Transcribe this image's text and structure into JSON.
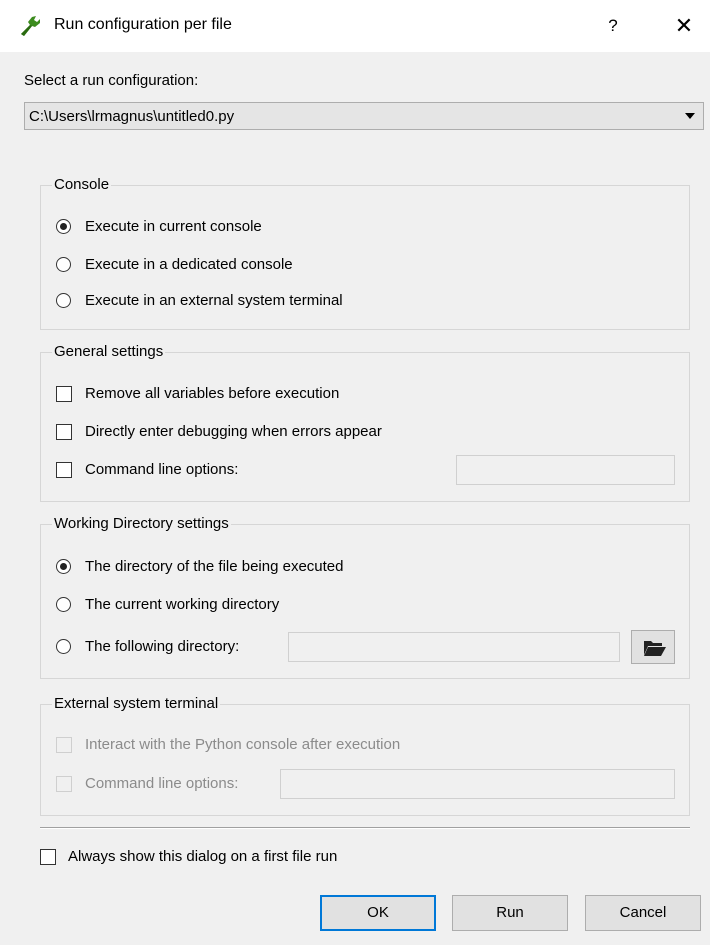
{
  "window": {
    "title": "Run configuration per file",
    "help": "?",
    "close": "✕"
  },
  "selector": {
    "label": "Select a run configuration:",
    "value": "C:\\Users\\lrmagnus\\untitled0.py"
  },
  "console": {
    "title": "Console",
    "options": [
      {
        "label": "Execute in current console",
        "checked": true
      },
      {
        "label": "Execute in a dedicated console",
        "checked": false
      },
      {
        "label": "Execute in an external system terminal",
        "checked": false
      }
    ]
  },
  "general": {
    "title": "General settings",
    "remove_vars": "Remove all variables before execution",
    "debug": "Directly enter debugging when errors appear",
    "cmd_options": "Command line options:",
    "cmd_value": ""
  },
  "workdir": {
    "title": "Working Directory settings",
    "options": [
      {
        "label": "The directory of the file being executed",
        "checked": true
      },
      {
        "label": "The current working directory",
        "checked": false
      },
      {
        "label": "The following directory:",
        "checked": false
      }
    ],
    "dir_value": ""
  },
  "external": {
    "title": "External system terminal",
    "interact": "Interact with the Python console after execution",
    "cmd_options": "Command line options:",
    "cmd_value": ""
  },
  "always_show": "Always show this dialog on a first file run",
  "buttons": {
    "ok": "OK",
    "run": "Run",
    "cancel": "Cancel"
  },
  "colors": {
    "accent": "#0078d7",
    "icon_green": "#3c8c1e",
    "background": "#f0f0f0"
  }
}
